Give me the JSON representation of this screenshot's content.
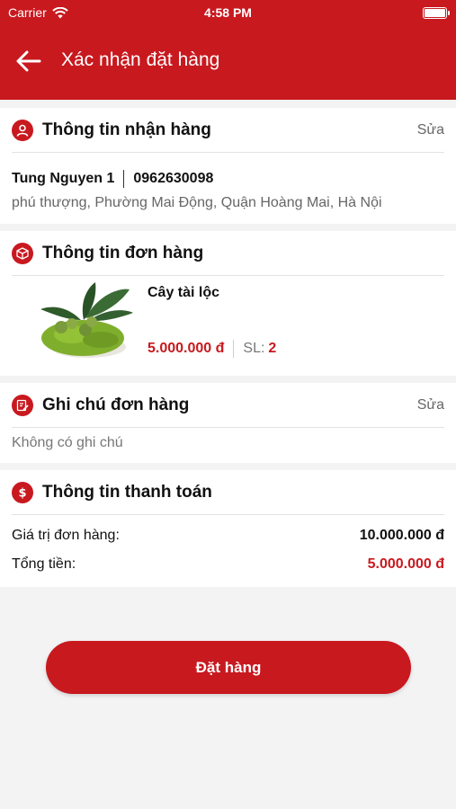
{
  "status_bar": {
    "carrier": "Carrier",
    "time": "4:58 PM"
  },
  "nav": {
    "title": "Xác nhận đặt hàng"
  },
  "receiver": {
    "title": "Thông tin nhận hàng",
    "edit_label": "Sửa",
    "name": "Tung Nguyen 1",
    "phone": "0962630098",
    "address": "phú thượng, Phường Mai Động, Quận Hoàng Mai, Hà Nội"
  },
  "order": {
    "title": "Thông tin đơn hàng",
    "product": {
      "name": "Cây tài lộc",
      "price": "5.000.000 đ",
      "qty_label": "SL:",
      "qty": "2"
    }
  },
  "note": {
    "title": "Ghi chú đơn hàng",
    "edit_label": "Sửa",
    "text": "Không có ghi chú"
  },
  "payment": {
    "title": "Thông tin thanh toán",
    "order_value_label": "Giá trị đơn hàng:",
    "order_value": "10.000.000 đ",
    "total_label": "Tổng tiền:",
    "total": "5.000.000 đ"
  },
  "action": {
    "submit_label": "Đặt hàng"
  },
  "colors": {
    "brand": "#c8191f",
    "background": "#f3f3f3"
  }
}
